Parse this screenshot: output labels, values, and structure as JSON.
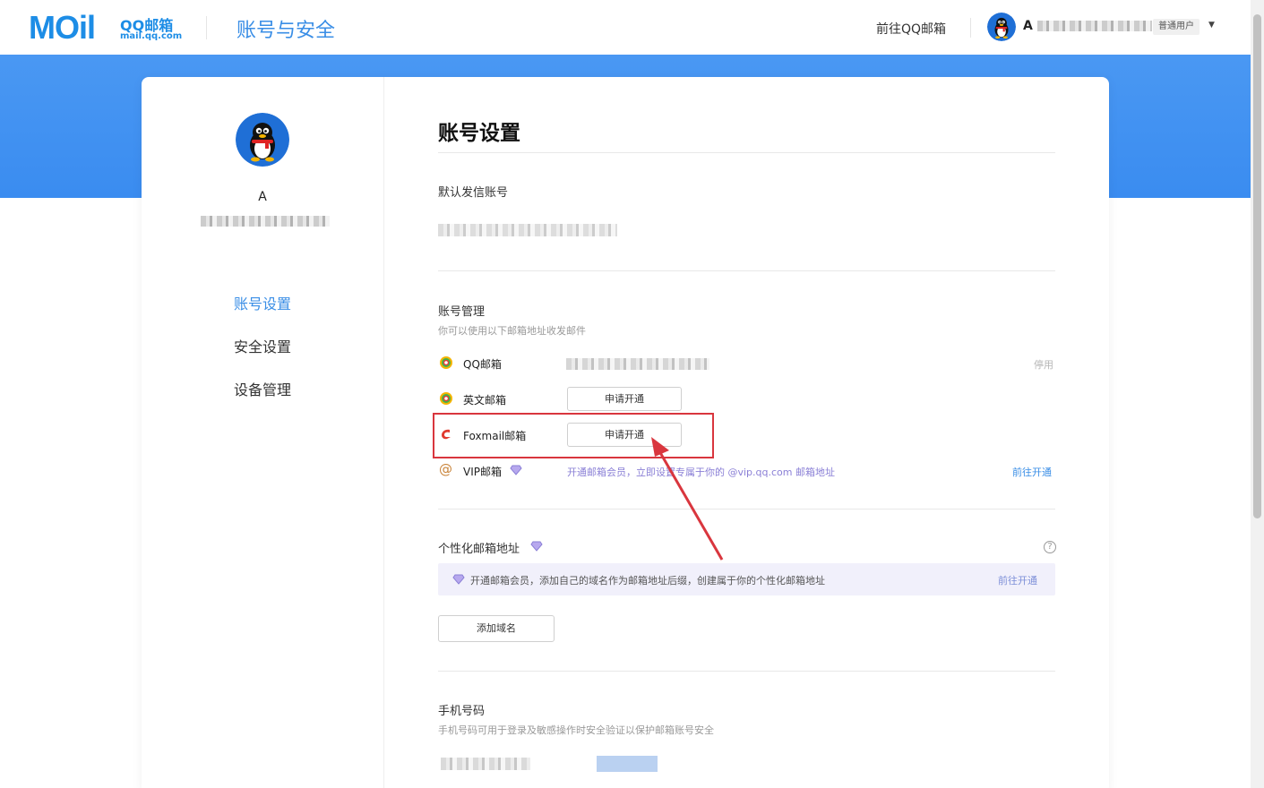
{
  "header": {
    "logo_word": "MOil",
    "logo_zh": "QQ邮箱",
    "logo_domain": "mail.qq.com",
    "title": "账号与安全",
    "goto_qq": "前往QQ邮箱",
    "user_initial": "A",
    "user_badge": "普通用户",
    "dropdown_icon": "caret-down-icon"
  },
  "sidebar": {
    "name": "A",
    "items": [
      {
        "label": "账号设置",
        "active": true
      },
      {
        "label": "安全设置",
        "active": false
      },
      {
        "label": "设备管理",
        "active": false
      }
    ]
  },
  "main": {
    "title": "账号设置",
    "default_sender": {
      "label": "默认发信账号"
    },
    "account_management": {
      "title": "账号管理",
      "subtitle": "你可以使用以下邮箱地址收发邮件",
      "rows": [
        {
          "icon": "qqmail-icon",
          "label": "QQ邮箱",
          "action": "停用"
        },
        {
          "icon": "qqmail-icon",
          "label": "英文邮箱",
          "button": "申请开通"
        },
        {
          "icon": "foxmail-icon",
          "label": "Foxmail邮箱",
          "button": "申请开通"
        },
        {
          "icon": "at-sign-icon",
          "label": "VIP邮箱",
          "promo": "开通邮箱会员，立即设置专属于你的 @vip.qq.com 邮箱地址",
          "link": "前往开通"
        }
      ]
    },
    "custom_domain": {
      "title": "个性化邮箱地址",
      "banner_text": "开通邮箱会员，添加自己的域名作为邮箱地址后缀，创建属于你的个性化邮箱地址",
      "banner_link": "前往开通",
      "button": "添加域名"
    },
    "phone": {
      "title": "手机号码",
      "subtitle": "手机号码可用于登录及敏感操作时安全验证以保护邮箱账号安全"
    }
  },
  "colors": {
    "accent": "#3a8ee6",
    "band": "#4a98f3",
    "highlight": "#d9363e",
    "vip_purple": "#8a7fd6"
  }
}
